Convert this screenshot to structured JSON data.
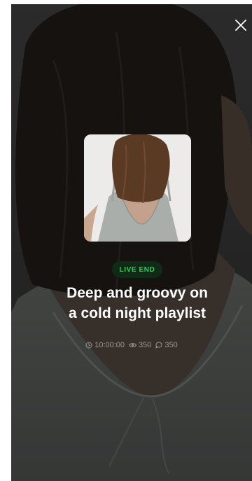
{
  "header": {
    "close_icon": "close-icon"
  },
  "status": {
    "badge_label": "LIVE END",
    "badge_text_color": "#22d35a",
    "badge_bg_color": "#0f2a15"
  },
  "playlist": {
    "title_line1": "Deep and groovy on",
    "title_line2": "a cold night playlist"
  },
  "stats": {
    "duration": "10:00:00",
    "views": "350",
    "comments": "350",
    "duration_icon": "clock-icon",
    "views_icon": "eye-icon",
    "comments_icon": "comment-icon"
  }
}
